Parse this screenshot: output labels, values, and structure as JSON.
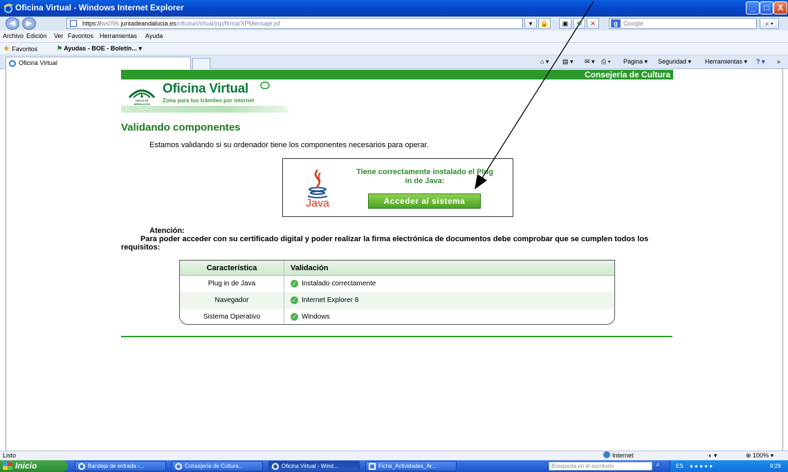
{
  "window": {
    "title": "Oficina Virtual - Windows Internet Explorer",
    "minimize": "_",
    "maximize": "□",
    "close": "X"
  },
  "address": {
    "url_prefix": "https://",
    "url_gray1": "ws096.",
    "url_host": "juntadeandalucia.es",
    "url_path": "/oficinaVirtual/jsp/firma/XPMensaje.jsf",
    "search_placeholder": "Google"
  },
  "menu": [
    "Archivo",
    "Edición",
    "Ver",
    "Favoritos",
    "Herramientas",
    "Ayuda"
  ],
  "favorites": {
    "label": "Favoritos",
    "link": "Ayudas - BOE - Boletín..."
  },
  "tab": {
    "label": "Oficina Virtual"
  },
  "commandbar": {
    "page": "Página ▾",
    "security": "Seguridad ▾",
    "tools": "Herramientas ▾"
  },
  "page": {
    "region": "Consejería de Cultura",
    "logo_org": "JUNTA DE ANDALUCIA",
    "logo_title": "Oficina Virtual",
    "logo_subtitle": "Zona para tus trámites por internet",
    "heading": "Validando componentes",
    "intro": "Estamos validando si su ordenador tiene los componentes necesarios para operar.",
    "java_logo_text": "Java",
    "java_message": "Tiene correctamente instalado el Plug in de Java:",
    "access_button": "Acceder al sistema",
    "attention_title": "Atención:",
    "attention_text": "Para poder acceder con su certificado digital y poder realizar la firma electrónica de documentos debe comprobar que se cumplen todos los requisitos:",
    "table": {
      "headers": [
        "Característica",
        "Validación"
      ],
      "rows": [
        {
          "feature": "Plug in de Java",
          "status": "Instalado correctamente"
        },
        {
          "feature": "Navegador",
          "status": "Internet Explorer 8"
        },
        {
          "feature": "Sistema Operativo",
          "status": "Windows"
        }
      ]
    }
  },
  "status": {
    "left": "Listo",
    "zone": "Internet",
    "zoom": "100%"
  },
  "taskbar": {
    "start": "Inicio",
    "tasks": [
      "Bandeja de entrada -...",
      "Consejería de Cultura...",
      "Oficina Virtual - Wind...",
      "Ficha_Actividades_Ar..."
    ],
    "search_placeholder": "Búsqueda en el escritorio",
    "lang": "ES",
    "clock": "9:29"
  },
  "colors": {
    "brand_green": "#2b9a2b",
    "button_green": "#4aa324",
    "heading_green": "#1a7a1a",
    "xp_blue": "#0642c4"
  }
}
